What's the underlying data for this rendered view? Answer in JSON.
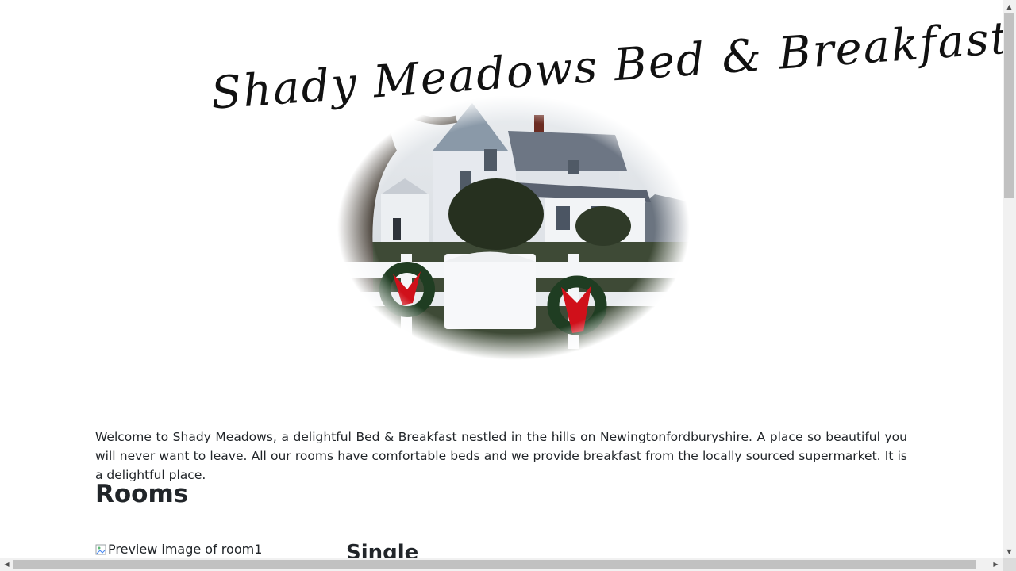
{
  "header": {
    "logo_text": "Shady Meadows Bed & Breakfast"
  },
  "intro": {
    "welcome_text": "Welcome to Shady Meadows, a delightful Bed & Breakfast nestled in the hills on Newingtonfordburyshire. A place so beautiful you will never want to leave. All our rooms have comfortable beds and we provide breakfast from the locally sourced supermarket. It is a delightful place."
  },
  "rooms": {
    "heading": "Rooms",
    "items": [
      {
        "image_alt": "Preview image of room1",
        "name": "Single"
      }
    ]
  },
  "icons": {
    "broken_image": "broken-image-icon",
    "scroll_up": "triangle-up-icon",
    "scroll_down": "triangle-down-icon",
    "scroll_left": "triangle-left-icon",
    "scroll_right": "triangle-right-icon"
  },
  "colors": {
    "text": "#212529",
    "background": "#ffffff",
    "wreath_bow": "#d0101a",
    "wreath_green": "#1f3d22"
  }
}
